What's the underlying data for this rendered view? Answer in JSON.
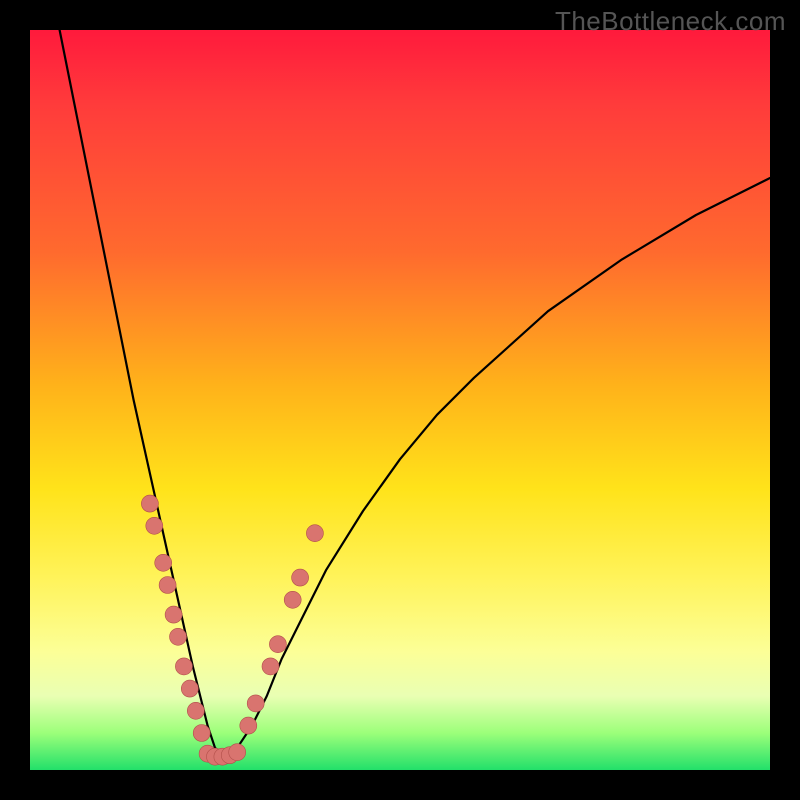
{
  "watermark": "TheBottleneck.com",
  "colors": {
    "gradient_top": "#ff1a3c",
    "gradient_mid1": "#ff6a2e",
    "gradient_mid2": "#ffe31a",
    "gradient_mid3": "#fcff97",
    "gradient_bottom": "#22e06a",
    "curve": "#000000",
    "bead_fill": "#d9746f",
    "bead_stroke": "#b24f4a",
    "frame": "#000000"
  },
  "chart_data": {
    "type": "line",
    "title": "",
    "xlabel": "",
    "ylabel": "",
    "xlim": [
      0,
      100
    ],
    "ylim": [
      0,
      100
    ],
    "notes": "V-shaped curve. Minimum (y≈0) near x≈25. Steep descent from top-left; shallower ascent toward right. Beads (data markers) cluster on both flanks of the valley roughly between y=5 and y=35, and along the flat bottom.",
    "series": [
      {
        "name": "curve",
        "x": [
          4,
          6,
          8,
          10,
          12,
          14,
          16,
          18,
          20,
          22,
          23,
          24,
          25,
          26,
          27,
          28,
          30,
          32,
          34,
          36,
          40,
          45,
          50,
          55,
          60,
          70,
          80,
          90,
          100
        ],
        "y": [
          100,
          90,
          80,
          70,
          60,
          50,
          41,
          32,
          23,
          14,
          10,
          6,
          3,
          2,
          2,
          3,
          6,
          10,
          15,
          19,
          27,
          35,
          42,
          48,
          53,
          62,
          69,
          75,
          80
        ]
      }
    ],
    "beads_left": [
      {
        "x": 16.2,
        "y": 36
      },
      {
        "x": 16.8,
        "y": 33
      },
      {
        "x": 18.0,
        "y": 28
      },
      {
        "x": 18.6,
        "y": 25
      },
      {
        "x": 19.4,
        "y": 21
      },
      {
        "x": 20.0,
        "y": 18
      },
      {
        "x": 20.8,
        "y": 14
      },
      {
        "x": 21.6,
        "y": 11
      },
      {
        "x": 22.4,
        "y": 8
      },
      {
        "x": 23.2,
        "y": 5
      }
    ],
    "beads_bottom": [
      {
        "x": 24.0,
        "y": 2.2
      },
      {
        "x": 25.0,
        "y": 1.8
      },
      {
        "x": 26.0,
        "y": 1.8
      },
      {
        "x": 27.0,
        "y": 2.0
      },
      {
        "x": 28.0,
        "y": 2.4
      }
    ],
    "beads_right": [
      {
        "x": 29.5,
        "y": 6
      },
      {
        "x": 30.5,
        "y": 9
      },
      {
        "x": 32.5,
        "y": 14
      },
      {
        "x": 33.5,
        "y": 17
      },
      {
        "x": 35.5,
        "y": 23
      },
      {
        "x": 36.5,
        "y": 26
      },
      {
        "x": 38.5,
        "y": 32
      }
    ]
  }
}
